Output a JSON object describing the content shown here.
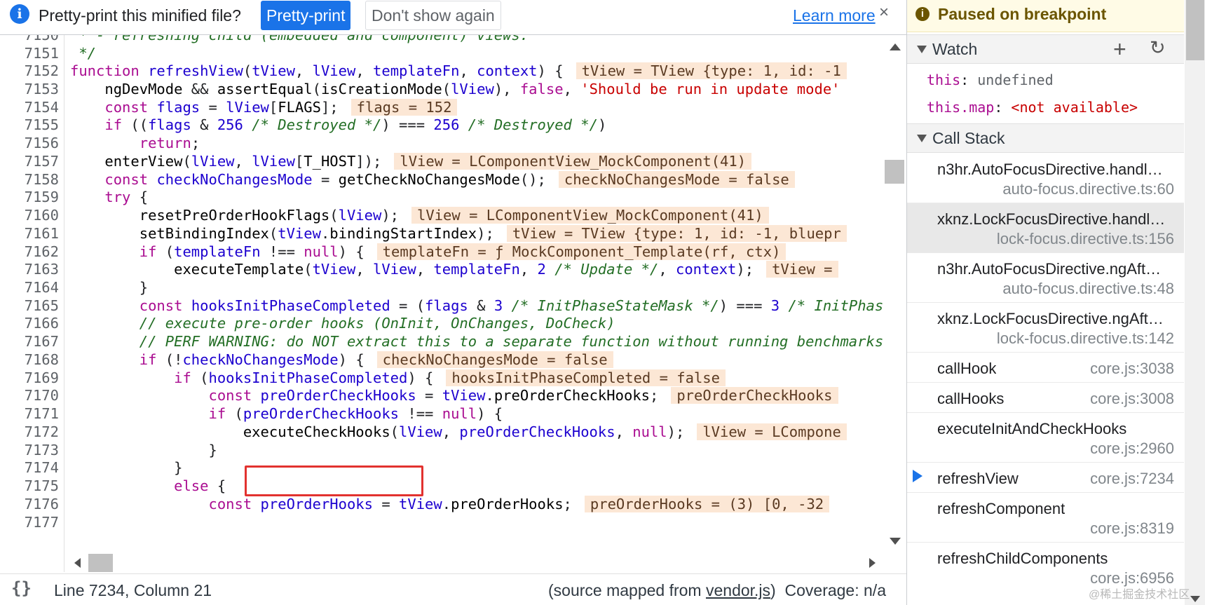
{
  "infobar": {
    "icon": "info-icon",
    "message": "Pretty-print this minified file?",
    "pretty_print_label": "Pretty-print",
    "dont_show_label": "Don't show again",
    "learn_more_label": "Learn more",
    "close_glyph": "×"
  },
  "editor": {
    "line_numbers": [
      "7150",
      "7151",
      "7152",
      "7153",
      "7154",
      "7155",
      "7156",
      "7157",
      "7158",
      "7159",
      "7160",
      "7161",
      "7162",
      "7163",
      "7164",
      "7165",
      "7166",
      "7167",
      "7168",
      "7169",
      "7170",
      "7171",
      "7172",
      "7173",
      "7174",
      "7175",
      "7176",
      "7177"
    ],
    "highlighted_call": "executeCheckHooks",
    "inline_values": {
      "l7152": "tView = TView {type: 1, id: -1",
      "l7154": "flags = 152",
      "l7157": "lView = LComponentView_MockComponent(41)",
      "l7158": "checkNoChangesMode = false",
      "l7160": "lView = LComponentView_MockComponent(41)",
      "l7161": "tView = TView {type: 1, id: -1, bluepr",
      "l7162": "templateFn = ƒ MockComponent_Template(rf, ctx)",
      "l7163": "tView =",
      "l7168": "checkNoChangesMode = false",
      "l7169": "hooksInitPhaseCompleted = false",
      "l7170": "preOrderCheckHooks",
      "l7172": "lView = LCompone",
      "l7176": "preOrderHooks = (3) [0, -32"
    }
  },
  "statusbar": {
    "braces_icon": "{}",
    "position": "Line 7234, Column 21",
    "source_prefix": "(source mapped from ",
    "source_file": "vendor.js",
    "source_suffix": ")",
    "coverage": "Coverage: n/a"
  },
  "debugger": {
    "paused_text": "Paused on breakpoint",
    "watch": {
      "title": "Watch",
      "add_glyph": "+",
      "refresh_glyph": "↻",
      "items": [
        {
          "key": "this",
          "sep": ": ",
          "value": "undefined"
        },
        {
          "key": "this.map",
          "sep": ": ",
          "value": "<not available>"
        }
      ]
    },
    "call_stack": {
      "title": "Call Stack",
      "frames": [
        {
          "name": "n3hr.AutoFocusDirective.handl…",
          "location": "auto-focus.directive.ts:60"
        },
        {
          "name": "xknz.LockFocusDirective.handl…",
          "location": "lock-focus.directive.ts:156"
        },
        {
          "name": "n3hr.AutoFocusDirective.ngAft…",
          "location": "auto-focus.directive.ts:48"
        },
        {
          "name": "xknz.LockFocusDirective.ngAft…",
          "location": "lock-focus.directive.ts:142"
        },
        {
          "name": "callHook",
          "location": "core.js:3038"
        },
        {
          "name": "callHooks",
          "location": "core.js:3008"
        },
        {
          "name": "executeInitAndCheckHooks",
          "location": "core.js:2960"
        },
        {
          "name": "refreshView",
          "location": "core.js:7234"
        },
        {
          "name": "refreshComponent",
          "location": "core.js:8319"
        },
        {
          "name": "refreshChildComponents",
          "location": "core.js:6956"
        }
      ]
    }
  },
  "watermark": "@稀土掘金技术社区"
}
